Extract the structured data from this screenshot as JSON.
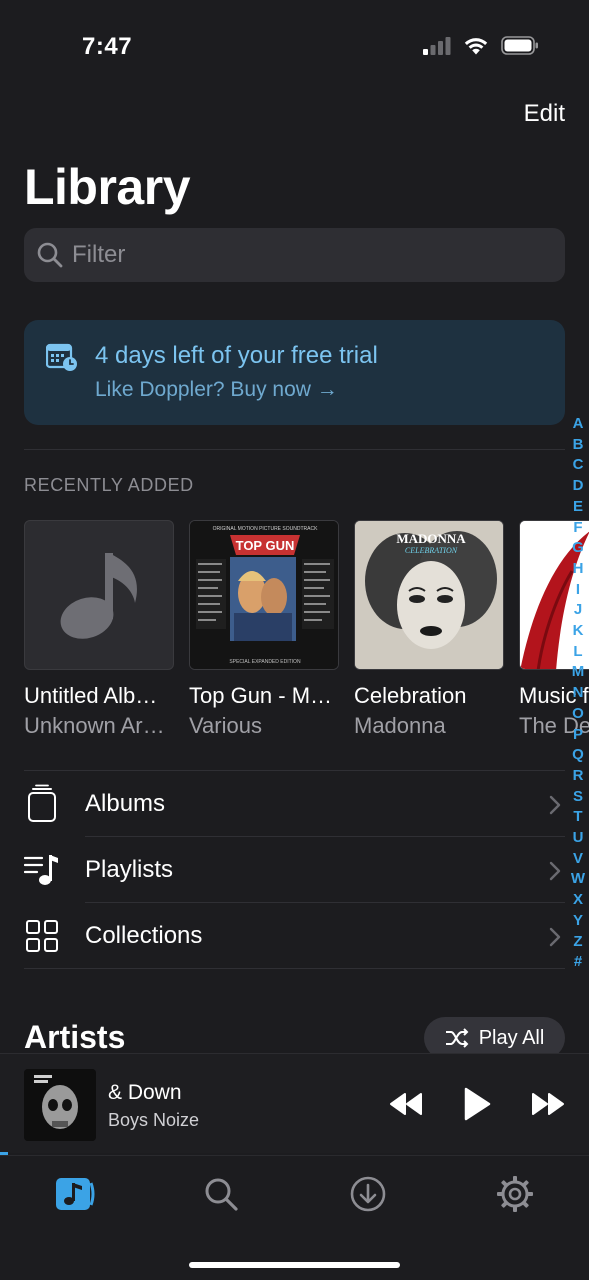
{
  "status": {
    "time": "7:47"
  },
  "header": {
    "edit_label": "Edit",
    "title": "Library"
  },
  "search": {
    "placeholder": "Filter"
  },
  "trial": {
    "title": "4 days left of your free trial",
    "subtitle": "Like Doppler? Buy now →",
    "accent": "#7cc4f0"
  },
  "recent": {
    "label": "RECENTLY ADDED",
    "albums": [
      {
        "title": "Untitled Alb…",
        "artist": "Unknown Ar…",
        "art": "music-note-placeholder"
      },
      {
        "title": "Top Gun - M…",
        "artist": "Various",
        "art": "top-gun-cover",
        "cover_text": "TOP GUN",
        "cover_top": "ORIGINAL MOTION PICTURE SOUNDTRACK",
        "cover_bottom": "SPECIAL EXPANDED EDITION"
      },
      {
        "title": "Celebration",
        "artist": "Madonna",
        "art": "celebration-cover",
        "cover_text": "MADONNA",
        "cover_sub": "CELEBRATION"
      },
      {
        "title": "Music f",
        "artist": "The De",
        "art": "red-shoe-cover"
      }
    ]
  },
  "library_rows": [
    {
      "label": "Albums",
      "icon": "albums-icon"
    },
    {
      "label": "Playlists",
      "icon": "playlists-icon"
    },
    {
      "label": "Collections",
      "icon": "collections-icon"
    }
  ],
  "index_letters": [
    "A",
    "B",
    "C",
    "D",
    "E",
    "F",
    "G",
    "H",
    "I",
    "J",
    "K",
    "L",
    "M",
    "N",
    "O",
    "P",
    "Q",
    "R",
    "S",
    "T",
    "U",
    "V",
    "W",
    "X",
    "Y",
    "Z",
    "#"
  ],
  "artists": {
    "title": "Artists",
    "play_all_label": "Play All"
  },
  "now_playing": {
    "title": "& Down",
    "artist": "Boys Noize",
    "progress": 0.013
  },
  "tabs": [
    {
      "name": "library",
      "icon": "music-library-icon",
      "active": true
    },
    {
      "name": "search",
      "icon": "search-icon",
      "active": false
    },
    {
      "name": "downloads",
      "icon": "download-icon",
      "active": false
    },
    {
      "name": "settings",
      "icon": "gear-icon",
      "active": false
    }
  ],
  "colors": {
    "background": "#1c1c1f",
    "accent": "#3ba3e6",
    "trial_bg": "#1e3140"
  }
}
